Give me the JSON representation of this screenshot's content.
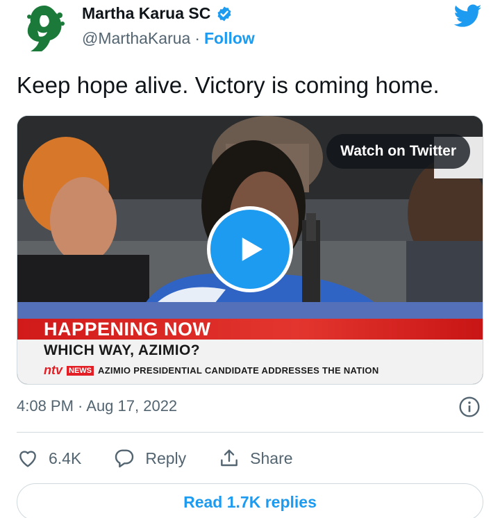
{
  "author": {
    "display_name": "Martha Karua SC",
    "handle": "@MarthaKarua",
    "separator": "·",
    "follow_label": "Follow",
    "verified": true,
    "avatar_icon": "green-silhouette-logo-icon",
    "brand_icon": "twitter-bird-icon"
  },
  "tweet": {
    "text": "Keep hope alive. Victory is coming home.",
    "timestamp": "4:08 PM · Aug 17, 2022"
  },
  "media": {
    "watch_label": "Watch on Twitter",
    "play_icon": "play-icon",
    "lower_third": {
      "banner": "HAPPENING NOW",
      "headline": "WHICH WAY, AZIMIO?",
      "channel": "ntv",
      "badge": "NEWS",
      "subline": "AZIMIO PRESIDENTIAL CANDIDATE ADDRESSES THE NATION"
    }
  },
  "actions": {
    "like_count": "6.4K",
    "reply_label": "Reply",
    "share_label": "Share"
  },
  "replies_button": "Read 1.7K replies",
  "colors": {
    "accent": "#1d9bf0",
    "text_primary": "#0f1419",
    "text_secondary": "#536471",
    "avatar_green": "#1b7a3a"
  }
}
